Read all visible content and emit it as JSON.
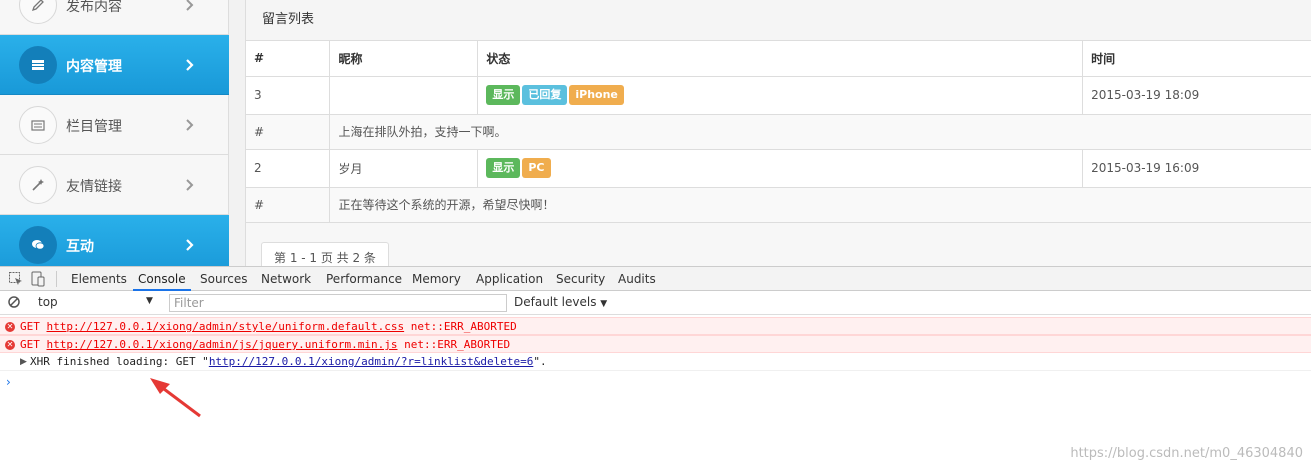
{
  "sidebar": {
    "items": [
      {
        "label": "发布内容",
        "icon": "pencil-icon",
        "active": false
      },
      {
        "label": "内容管理",
        "icon": "list-icon",
        "active": true
      },
      {
        "label": "栏目管理",
        "icon": "column-icon",
        "active": false
      },
      {
        "label": "友情链接",
        "icon": "magic-wand-icon",
        "active": false
      },
      {
        "label": "互动",
        "icon": "chat-icon",
        "active": true
      }
    ]
  },
  "panel": {
    "title": "留言列表",
    "columns": [
      "#",
      "昵称",
      "状态",
      "时间"
    ],
    "rows": [
      {
        "id": "3",
        "nick": "",
        "badges": [
          "显示",
          "已回复",
          "iPhone"
        ],
        "time": "2015-03-19 18:09",
        "msg_hash": "#",
        "message": "上海在排队外拍，支持一下啊。"
      },
      {
        "id": "2",
        "nick": "岁月",
        "badges": [
          "显示",
          "PC"
        ],
        "time": "2015-03-19 16:09",
        "msg_hash": "#",
        "message": "正在等待这个系统的开源，希望尽快啊！"
      }
    ],
    "pager": "第 1 - 1 页 共 2 条"
  },
  "devtools": {
    "tabs": [
      "Elements",
      "Console",
      "Sources",
      "Network",
      "Performance",
      "Memory",
      "Application",
      "Security",
      "Audits"
    ],
    "active_tab": "Console",
    "context": "top",
    "filter_placeholder": "Filter",
    "levels": "Default levels",
    "log": [
      {
        "type": "error",
        "method": "GET",
        "url": "http://127.0.0.1/xiong/admin/style/uniform.default.css",
        "status": "net::ERR_ABORTED"
      },
      {
        "type": "error",
        "method": "GET",
        "url": "http://127.0.0.1/xiong/admin/js/jquery.uniform.min.js",
        "status": "net::ERR_ABORTED"
      },
      {
        "type": "info",
        "prefix": "XHR finished loading: GET \"",
        "url": "http://127.0.0.1/xiong/admin/?r=linklist&delete=6",
        "suffix": "\"."
      }
    ]
  },
  "watermark": "https://blog.csdn.net/m0_46304840",
  "colors": {
    "accent": "#1999d8",
    "green": "#5cb85c",
    "blue": "#5bc0de",
    "orange": "#f0ad4e",
    "error": "#e53935"
  }
}
